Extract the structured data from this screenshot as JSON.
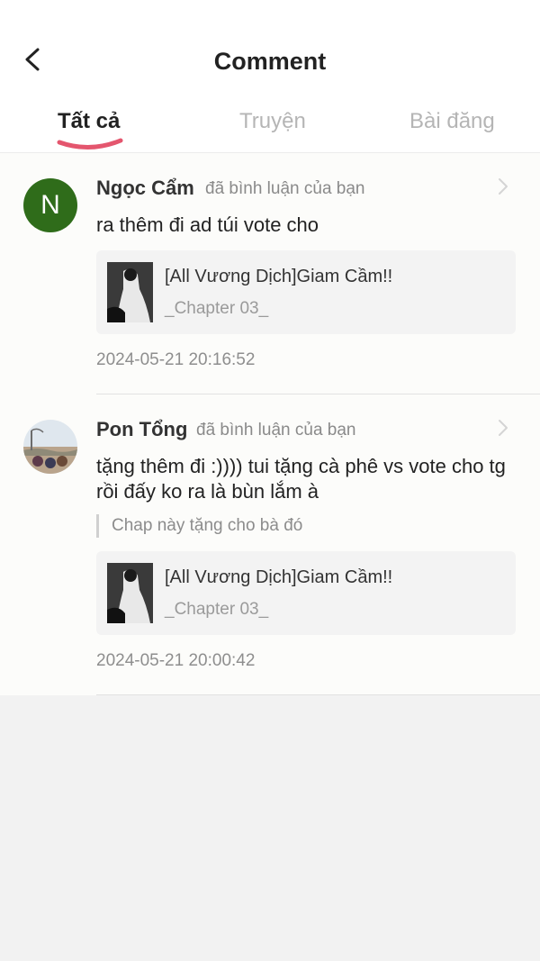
{
  "header": {
    "title": "Comment",
    "tabs": [
      {
        "label": "Tất cả",
        "active": true
      },
      {
        "label": "Truyện",
        "active": false
      },
      {
        "label": "Bài đăng",
        "active": false
      }
    ]
  },
  "colors": {
    "active_underline": "#e4566e",
    "avatar_green": "#2f6c1a",
    "page_bg": "#f2f2f2"
  },
  "comments": [
    {
      "avatar_letter": "N",
      "username": "Ngọc Cẩm",
      "action": "đã bình luận của bạn",
      "text": "ra thêm đi ad túi vote cho",
      "story_title": "[All Vương Dịch]Giam Cầm!!",
      "chapter": "_Chapter 03_",
      "timestamp": "2024-05-21 20:16:52"
    },
    {
      "username": "Pon Tổng",
      "action": "đã bình luận của bạn",
      "text": "tặng thêm đi :)))) tui tặng cà phê vs vote cho tg rồi đấy ko ra là bùn lắm à",
      "quote": "Chap này tặng cho bà đó",
      "story_title": "[All Vương Dịch]Giam Cầm!!",
      "chapter": "_Chapter 03_",
      "timestamp": "2024-05-21 20:00:42"
    }
  ]
}
